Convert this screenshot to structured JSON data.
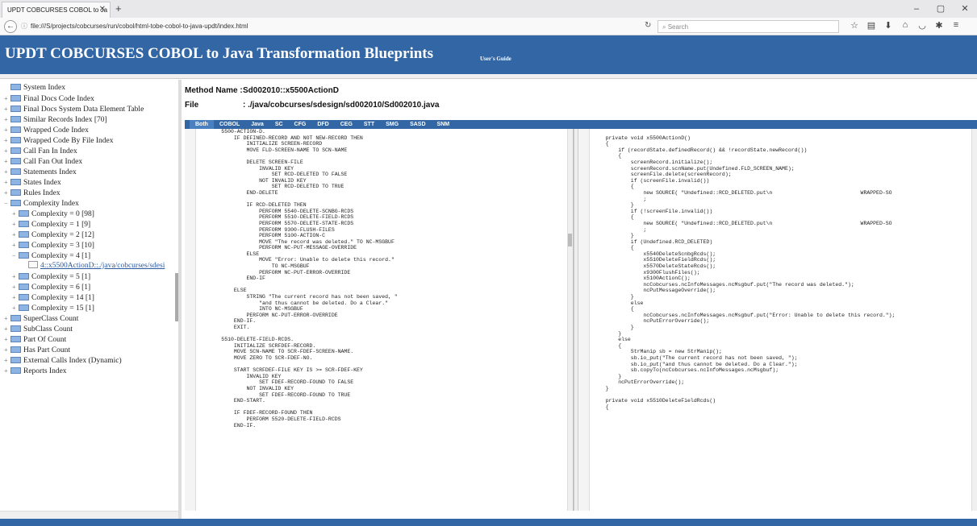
{
  "browser": {
    "tab_title": "UPDT COBCURSES COBOL to Ja",
    "url": "file:///S/projects/cobcurses/run/cobol/html-tobe-cobol-to-java-updt/index.html",
    "search_placeholder": "Search",
    "win_min": "–",
    "win_max": "▢",
    "win_close": "✕"
  },
  "header": {
    "title": "UPDT COBCURSES COBOL to Java Transformation Blueprints",
    "guide_link": "User's Guide"
  },
  "sidebar": {
    "nodes": [
      {
        "label": "System Index",
        "pm": "",
        "level": 0,
        "icon": "folder"
      },
      {
        "label": "Final Docs Code Index",
        "pm": "+",
        "level": 0,
        "icon": "folder"
      },
      {
        "label": "Final Docs System Data Element Table",
        "pm": "+",
        "level": 0,
        "icon": "folder"
      },
      {
        "label": "Similar Records Index [70]",
        "pm": "+",
        "level": 0,
        "icon": "folder"
      },
      {
        "label": "Wrapped Code Index",
        "pm": "+",
        "level": 0,
        "icon": "folder"
      },
      {
        "label": "Wrapped Code By File Index",
        "pm": "+",
        "level": 0,
        "icon": "folder"
      },
      {
        "label": "Call Fan In Index",
        "pm": "+",
        "level": 0,
        "icon": "folder"
      },
      {
        "label": "Call Fan Out Index",
        "pm": "+",
        "level": 0,
        "icon": "folder"
      },
      {
        "label": "Statements Index",
        "pm": "+",
        "level": 0,
        "icon": "folder"
      },
      {
        "label": "States Index",
        "pm": "+",
        "level": 0,
        "icon": "folder"
      },
      {
        "label": "Rules Index",
        "pm": "+",
        "level": 0,
        "icon": "folder"
      },
      {
        "label": "Complexity Index",
        "pm": "−",
        "level": 0,
        "icon": "folder"
      },
      {
        "label": "Complexity = 0 [98]",
        "pm": "+",
        "level": 1,
        "icon": "folder"
      },
      {
        "label": "Complexity = 1 [9]",
        "pm": "+",
        "level": 1,
        "icon": "folder"
      },
      {
        "label": "Complexity = 2 [12]",
        "pm": "+",
        "level": 1,
        "icon": "folder"
      },
      {
        "label": "Complexity = 3 [10]",
        "pm": "+",
        "level": 1,
        "icon": "folder"
      },
      {
        "label": "Complexity = 4 [1]",
        "pm": "−",
        "level": 1,
        "icon": "folder"
      },
      {
        "label": "4::x5500ActionD::./java/cobcurses/sdesi",
        "pm": "",
        "level": 2,
        "icon": "doc"
      },
      {
        "label": "Complexity = 5 [1]",
        "pm": "+",
        "level": 1,
        "icon": "folder"
      },
      {
        "label": "Complexity = 6 [1]",
        "pm": "+",
        "level": 1,
        "icon": "folder"
      },
      {
        "label": "Complexity = 14 [1]",
        "pm": "+",
        "level": 1,
        "icon": "folder"
      },
      {
        "label": "Complexity = 15 [1]",
        "pm": "+",
        "level": 1,
        "icon": "folder"
      },
      {
        "label": "SuperClass Count",
        "pm": "+",
        "level": 0,
        "icon": "folder"
      },
      {
        "label": "SubClass Count",
        "pm": "+",
        "level": 0,
        "icon": "folder"
      },
      {
        "label": "Part Of Count",
        "pm": "+",
        "level": 0,
        "icon": "folder"
      },
      {
        "label": "Has Part Count",
        "pm": "+",
        "level": 0,
        "icon": "folder"
      },
      {
        "label": "External Calls Index (Dynamic)",
        "pm": "+",
        "level": 0,
        "icon": "folder"
      },
      {
        "label": "Reports Index",
        "pm": "+",
        "level": 0,
        "icon": "folder"
      }
    ]
  },
  "method": {
    "name_label": "Method Name :",
    "name_value": "Sd002010::x5500ActionD",
    "file_label": "File",
    "file_value": ": ./java/cobcurses/sdesign/sd002010/Sd002010.java"
  },
  "tabs": [
    "Both",
    "COBOL",
    "Java",
    "SC",
    "CFG",
    "DFD",
    "CEG",
    "STT",
    "SMG",
    "SASD",
    "SNM"
  ],
  "cobol_code": [
    "       5500-ACTION-D.",
    "           IF DEFINED-RECORD AND NOT NEW-RECORD THEN",
    "               INITIALIZE SCREEN-RECORD",
    "               MOVE FLD-SCREEN-NAME TO SCN-NAME",
    "",
    "               DELETE SCREEN-FILE",
    "                   INVALID KEY",
    "                       SET RCD-DELETED TO FALSE",
    "                   NOT INVALID KEY",
    "                       SET RCD-DELETED TO TRUE",
    "               END-DELETE",
    "",
    "               IF RCD-DELETED THEN",
    "                   PERFORM 5540-DELETE-SCNBG-RCDS",
    "                   PERFORM 5510-DELETE-FIELD-RCDS",
    "                   PERFORM 5570-DELETE-STATE-RCDS",
    "                   PERFORM 9300-FLUSH-FILES",
    "                   PERFORM 5100-ACTION-C",
    "                   MOVE \"The record was deleted.\" TO NC-MSGBUF",
    "                   PERFORM NC-PUT-MESSAGE-OVERRIDE",
    "               ELSE",
    "                   MOVE \"Error: Unable to delete this record.\"",
    "                       TO NC-MSGBUF",
    "                   PERFORM NC-PUT-ERROR-OVERRIDE",
    "               END-IF",
    "",
    "           ELSE",
    "               STRING \"The current record has not been saved, \"",
    "                   \"and thus cannot be deleted. Do a Clear.\"",
    "                   INTO NC-MSGBUF",
    "               PERFORM NC-PUT-ERROR-OVERRIDE",
    "           END-IF.",
    "           EXIT.",
    "",
    "       5510-DELETE-FIELD-RCDS.",
    "           INITIALIZE SCRFDEF-RECORD.",
    "           MOVE SCN-NAME TO SCR-FDEF-SCREEN-NAME.",
    "           MOVE ZERO TO SCR-FDEF-NO.",
    "",
    "           START SCRFDEF-FILE KEY IS >= SCR-FDEF-KEY",
    "               INVALID KEY",
    "                   SET FDEF-RECORD-FOUND TO FALSE",
    "               NOT INVALID KEY",
    "                   SET FDEF-RECORD-FOUND TO TRUE",
    "           END-START.",
    "",
    "           IF FDEF-RECORD-FOUND THEN",
    "               PERFORM 5520-DELETE-FIELD-RCDS",
    "           END-IF."
  ],
  "java_code": [
    "",
    "    private void x5500ActionD()",
    "    {",
    "        if (recordState.definedRecord() && !recordState.newRecord())",
    "        {",
    "            screenRecord.initialize();",
    "            screenRecord.scnName.put(Undefined.FLD_SCREEN_NAME);",
    "            screenFile.delete(screenRecord);",
    "            if (screenFile.invalid())",
    "            {",
    "                new SOURCE( \"Undefined::RCD_DELETED.put\\n                            WRAPPED-SO",
    "                ;",
    "            }",
    "            if (!screenFile.invalid())",
    "            {",
    "                new SOURCE( \"Undefined::RCD_DELETED.put\\n                            WRAPPED-SO",
    "                ;",
    "            }",
    "            if (Undefined.RCD_DELETED)",
    "            {",
    "                x5540DeleteScnbgRcds();",
    "                x5510DeleteFieldRcds();",
    "                x5570DeleteStateRcds();",
    "                x9300FlushFiles();",
    "                x5100ActionC();",
    "                ncCobcurses.ncInfoMessages.ncMsgbuf.put(\"The record was deleted.\");",
    "                ncPutMessageOverride();",
    "            }",
    "            else",
    "            {",
    "                ncCobcurses.ncInfoMessages.ncMsgbuf.put(\"Error: Unable to delete this record.\");",
    "                ncPutErrorOverride();",
    "            }",
    "        }",
    "        else",
    "        {",
    "            StrManip sb = new StrManip();",
    "            sb.io_put(\"The current record has not been saved, \");",
    "            sb.io_put(\"and thus cannot be deleted. Do a Clear.\");",
    "            sb.copyTo(ncCobcurses.ncInfoMessages.ncMsgbuf);",
    "        }",
    "        ncPutErrorOverride();",
    "    }",
    "",
    "    private void x5510DeleteFieldRcds()",
    "    {"
  ],
  "colors": {
    "header_bg": "#3366a4",
    "link": "#2a3fb0"
  }
}
